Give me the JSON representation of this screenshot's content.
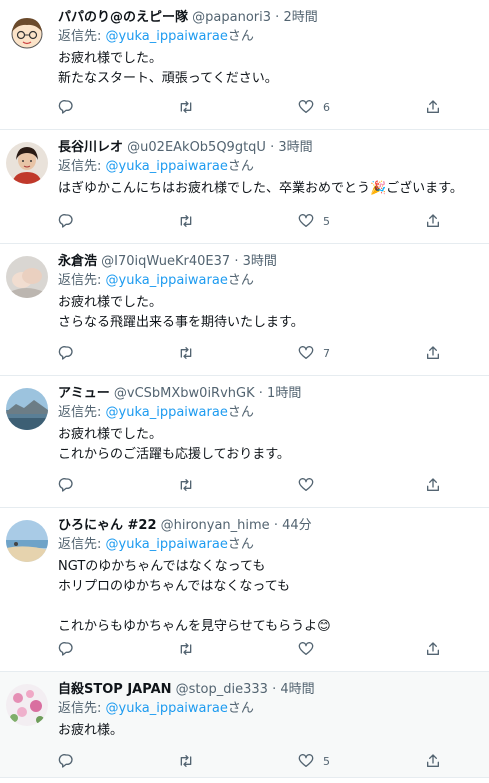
{
  "reply_prefix": "返信先:",
  "reply_suffix": "さん",
  "separator": "·",
  "tweets": [
    {
      "name": "パパのり@のえピー隊",
      "handle": "@papanori3",
      "time": "2時間",
      "mention": "@yuka_ippaiwarae",
      "body": "お疲れ様でした。\n新たなスタート、頑張ってください。",
      "likes": "6",
      "avatar": "cartoon-face"
    },
    {
      "name": "長谷川レオ",
      "handle": "@u02EAkOb5Q9gtqU",
      "time": "3時間",
      "mention": "@yuka_ippaiwarae",
      "body": "はぎゆかこんにちはお疲れ様でした、卒業おめでとう🎉ございます。",
      "likes": "5",
      "avatar": "portrait"
    },
    {
      "name": "永倉浩",
      "handle": "@I70iqWueKr40E37",
      "time": "3時間",
      "mention": "@yuka_ippaiwarae",
      "body": "お疲れ様でした。\nさらなる飛躍出来る事を期待いたします。",
      "likes": "7",
      "avatar": "hands"
    },
    {
      "name": "アミュー",
      "handle": "@vCSbMXbw0iRvhGK",
      "time": "1時間",
      "mention": "@yuka_ippaiwarae",
      "body": "お疲れ様でした。\nこれからのご活躍も応援しております。",
      "likes": "",
      "avatar": "landscape"
    },
    {
      "name": "ひろにゃん #22",
      "handle": "@hironyan_hime",
      "time": "44分",
      "mention": "@yuka_ippaiwarae",
      "body": "NGTのゆかちゃんではなくなっても\nホリプロのゆかちゃんではなくなっても\n\nこれからもゆかちゃんを見守らせてもらうよ😊",
      "likes": "",
      "avatar": "beach"
    },
    {
      "name": "自殺STOP JAPAN",
      "handle": "@stop_die333",
      "time": "4時間",
      "mention": "@yuka_ippaiwarae",
      "body": "お疲れ様。",
      "likes": "5",
      "avatar": "flowers"
    }
  ]
}
